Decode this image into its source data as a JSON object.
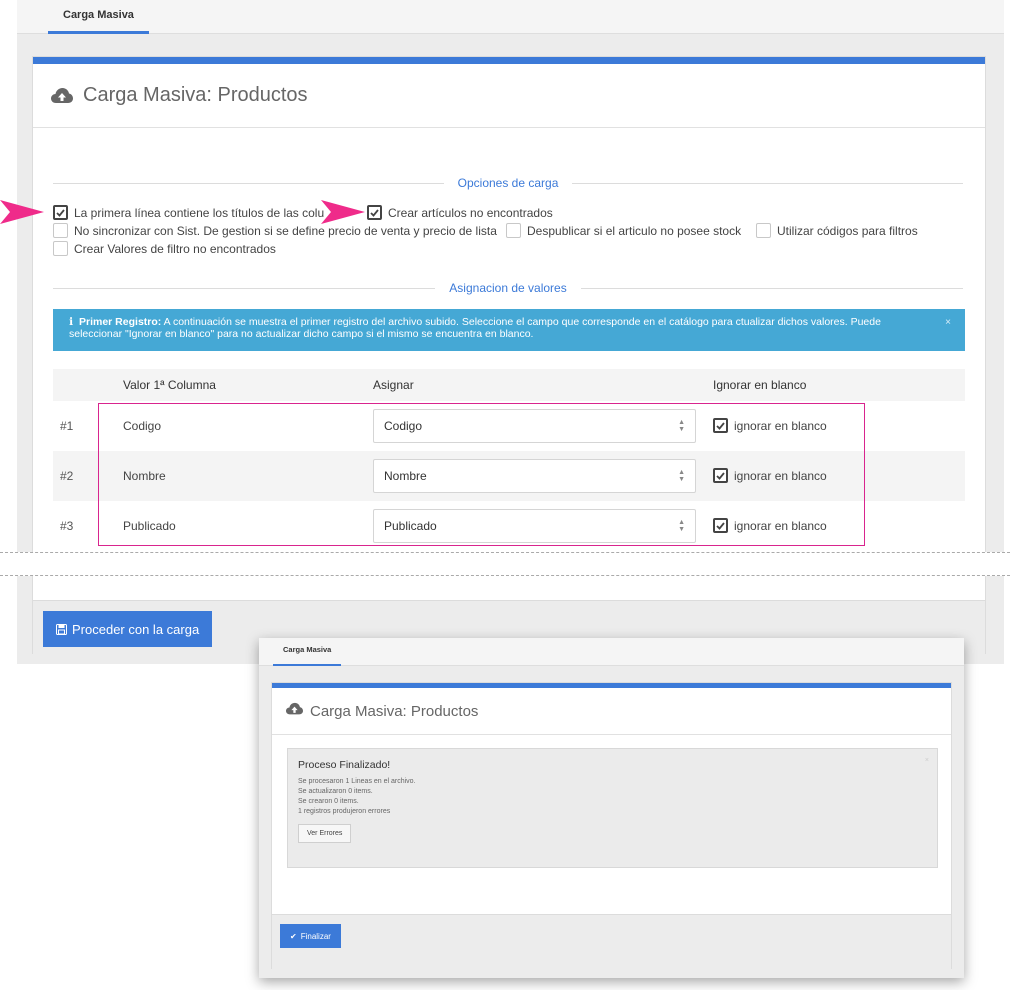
{
  "tab": {
    "label": "Carga Masiva"
  },
  "page": {
    "title": "Carga Masiva: Productos"
  },
  "sections": {
    "opciones": "Opciones de carga",
    "asignacion": "Asignacion de valores"
  },
  "options": [
    {
      "label": "La primera línea contiene los títulos de las colu",
      "checked": true
    },
    {
      "label": "Crear artículos no encontrados",
      "checked": true
    },
    {
      "label": "No sincronizar con Sist. De gestion si se define precio de venta y precio de lista",
      "checked": false
    },
    {
      "label": "Despublicar si el articulo no posee stock",
      "checked": false
    },
    {
      "label": "Utilizar códigos para filtros",
      "checked": false
    },
    {
      "label": "Crear Valores de filtro no encontrados",
      "checked": false
    }
  ],
  "alert": {
    "icon": "info-icon",
    "strong": "Primer Registro:",
    "text": " A continuación se muestra el primer registro del archivo subido. Seleccione el campo que corresponde en el catálogo para ctualizar dichos valores. Puede seleccionar \"Ignorar en blanco\" para no actualizar dicho campo si el mismo se encuentra en blanco.",
    "close": "×"
  },
  "table": {
    "headers": {
      "valor": "Valor 1ª Columna",
      "asignar": "Asignar",
      "ignorar": "Ignorar en blanco"
    },
    "rows": [
      {
        "idx": "#1",
        "value": "Codigo",
        "assign": "Codigo",
        "ignore_label": "ignorar en blanco",
        "ignore": true
      },
      {
        "idx": "#2",
        "value": "Nombre",
        "assign": "Nombre",
        "ignore_label": "ignorar en blanco",
        "ignore": true
      },
      {
        "idx": "#3",
        "value": "Publicado",
        "assign": "Publicado",
        "ignore_label": "ignorar en blanco",
        "ignore": true
      }
    ]
  },
  "footer": {
    "proceed_label": "Proceder con la carga"
  },
  "inset": {
    "tab_label": "Carga Masiva",
    "title": "Carga Masiva: Productos",
    "result": {
      "heading": "Proceso Finalizado!",
      "lines": [
        "Se procesaron 1 Lineas en el archivo.",
        "Se actualizaron 0 items.",
        "Se crearon 0 items.",
        "1 registros produjeron errores"
      ],
      "errors_button": "Ver Errores",
      "close": "×"
    },
    "finish_label": "Finalizar"
  },
  "colors": {
    "accent": "#3c7ad8",
    "info": "#45a8d5",
    "highlight": "#d9248e",
    "arrow": "#ef2b8a"
  }
}
